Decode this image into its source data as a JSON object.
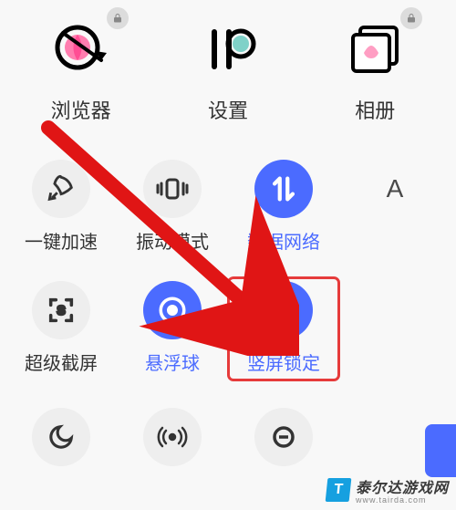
{
  "apps": [
    {
      "id": "browser",
      "label": "浏览器",
      "locked": true
    },
    {
      "id": "settings",
      "label": "设置",
      "locked": false
    },
    {
      "id": "gallery",
      "label": "相册",
      "locked": true
    }
  ],
  "tiles": {
    "boost": {
      "label": "一键加速",
      "active": false
    },
    "vibrate": {
      "label": "振动模式",
      "active": false
    },
    "data": {
      "label": "数据网络",
      "active": true
    },
    "font": {
      "label": "A"
    },
    "sshot": {
      "label": "超级截屏",
      "active": false
    },
    "float": {
      "label": "悬浮球",
      "active": true
    },
    "portrait": {
      "label": "竖屏锁定",
      "active": true
    },
    "moon": {
      "active": false
    },
    "hotspot": {
      "active": false
    },
    "ring": {
      "active": false
    }
  },
  "watermark": {
    "logo_letter": "T",
    "main": "泰尔达游戏网",
    "sub": "www.tairda.com"
  },
  "colors": {
    "accent": "#4b6bff",
    "highlight": "#e63b3b",
    "brand": "#16a0e0"
  }
}
